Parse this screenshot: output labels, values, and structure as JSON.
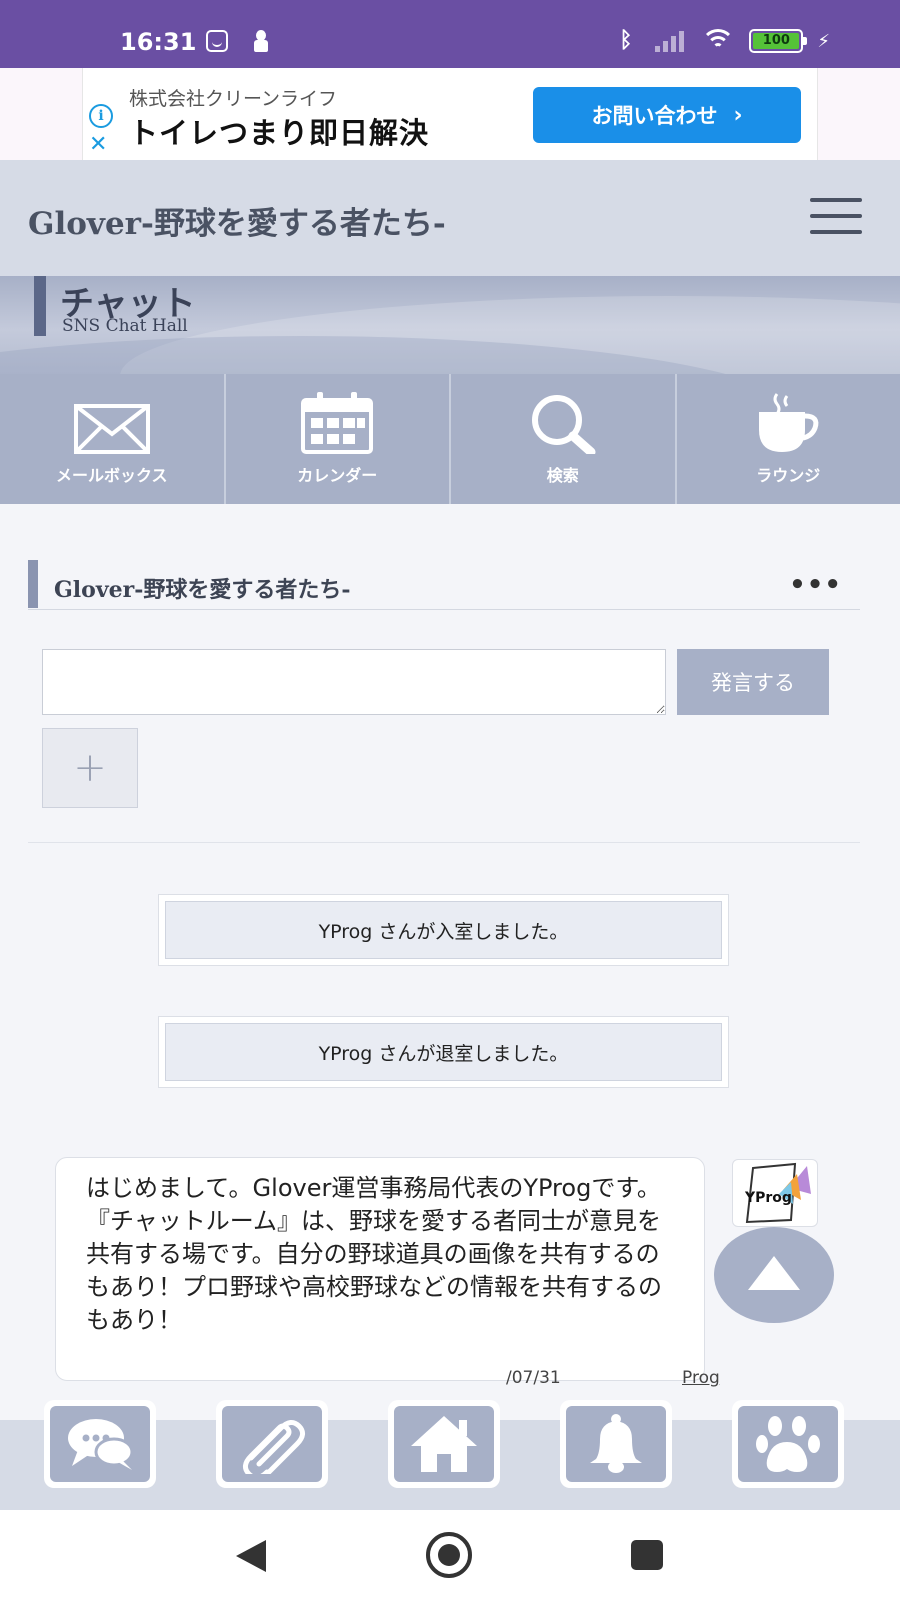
{
  "status_bar": {
    "time": "16:31",
    "battery": "100",
    "bolt": "⚡",
    "bluetooth": "ᛒ"
  },
  "ad": {
    "info": "i",
    "close": "✕",
    "company": "株式会社クリーンライフ",
    "headline": "トイレつまり即日解決",
    "cta_label": "お問い合わせ",
    "cta_chevron": "›"
  },
  "header": {
    "site_title": "Glover-野球を愛する者たち-"
  },
  "page_banner": {
    "title": "チャット",
    "subtitle": "SNS Chat Hall"
  },
  "nav_tiles": [
    {
      "label": "メールボックス",
      "icon": "mail-icon"
    },
    {
      "label": "カレンダー",
      "icon": "calendar-icon"
    },
    {
      "label": "検索",
      "icon": "search-icon"
    },
    {
      "label": "ラウンジ",
      "icon": "coffee-cup-icon"
    }
  ],
  "room": {
    "title": "Glover-野球を愛する者たち-",
    "more": "•••",
    "input_value": "",
    "post_label": "発言する",
    "attach_label": "+"
  },
  "system_messages": [
    "YProg さんが入室しました。",
    "YProg さんが退室しました。"
  ],
  "chat_message": {
    "text": "はじめまして。Glover運営事務局代表のYProgです。『チャットルーム』は、野球を愛する者同士が意見を共有する場です。自分の野球道具の画像を共有するのもあり！プロ野球や高校野球などの情報を共有するのもあり！",
    "avatar_text": "YProg",
    "date_fragment": "/07/31",
    "author_fragment": "Prog"
  },
  "bottom_bar": [
    {
      "icon": "chat-bubbles-icon"
    },
    {
      "icon": "paperclip-icon"
    },
    {
      "icon": "home-icon"
    },
    {
      "icon": "bell-icon"
    },
    {
      "icon": "paw-icon"
    }
  ],
  "colors": {
    "status_bar": "#6a4fa3",
    "accent": "#a7b0c7",
    "header_bg": "#d6dbe6",
    "ad_button": "#1a8fe8"
  }
}
